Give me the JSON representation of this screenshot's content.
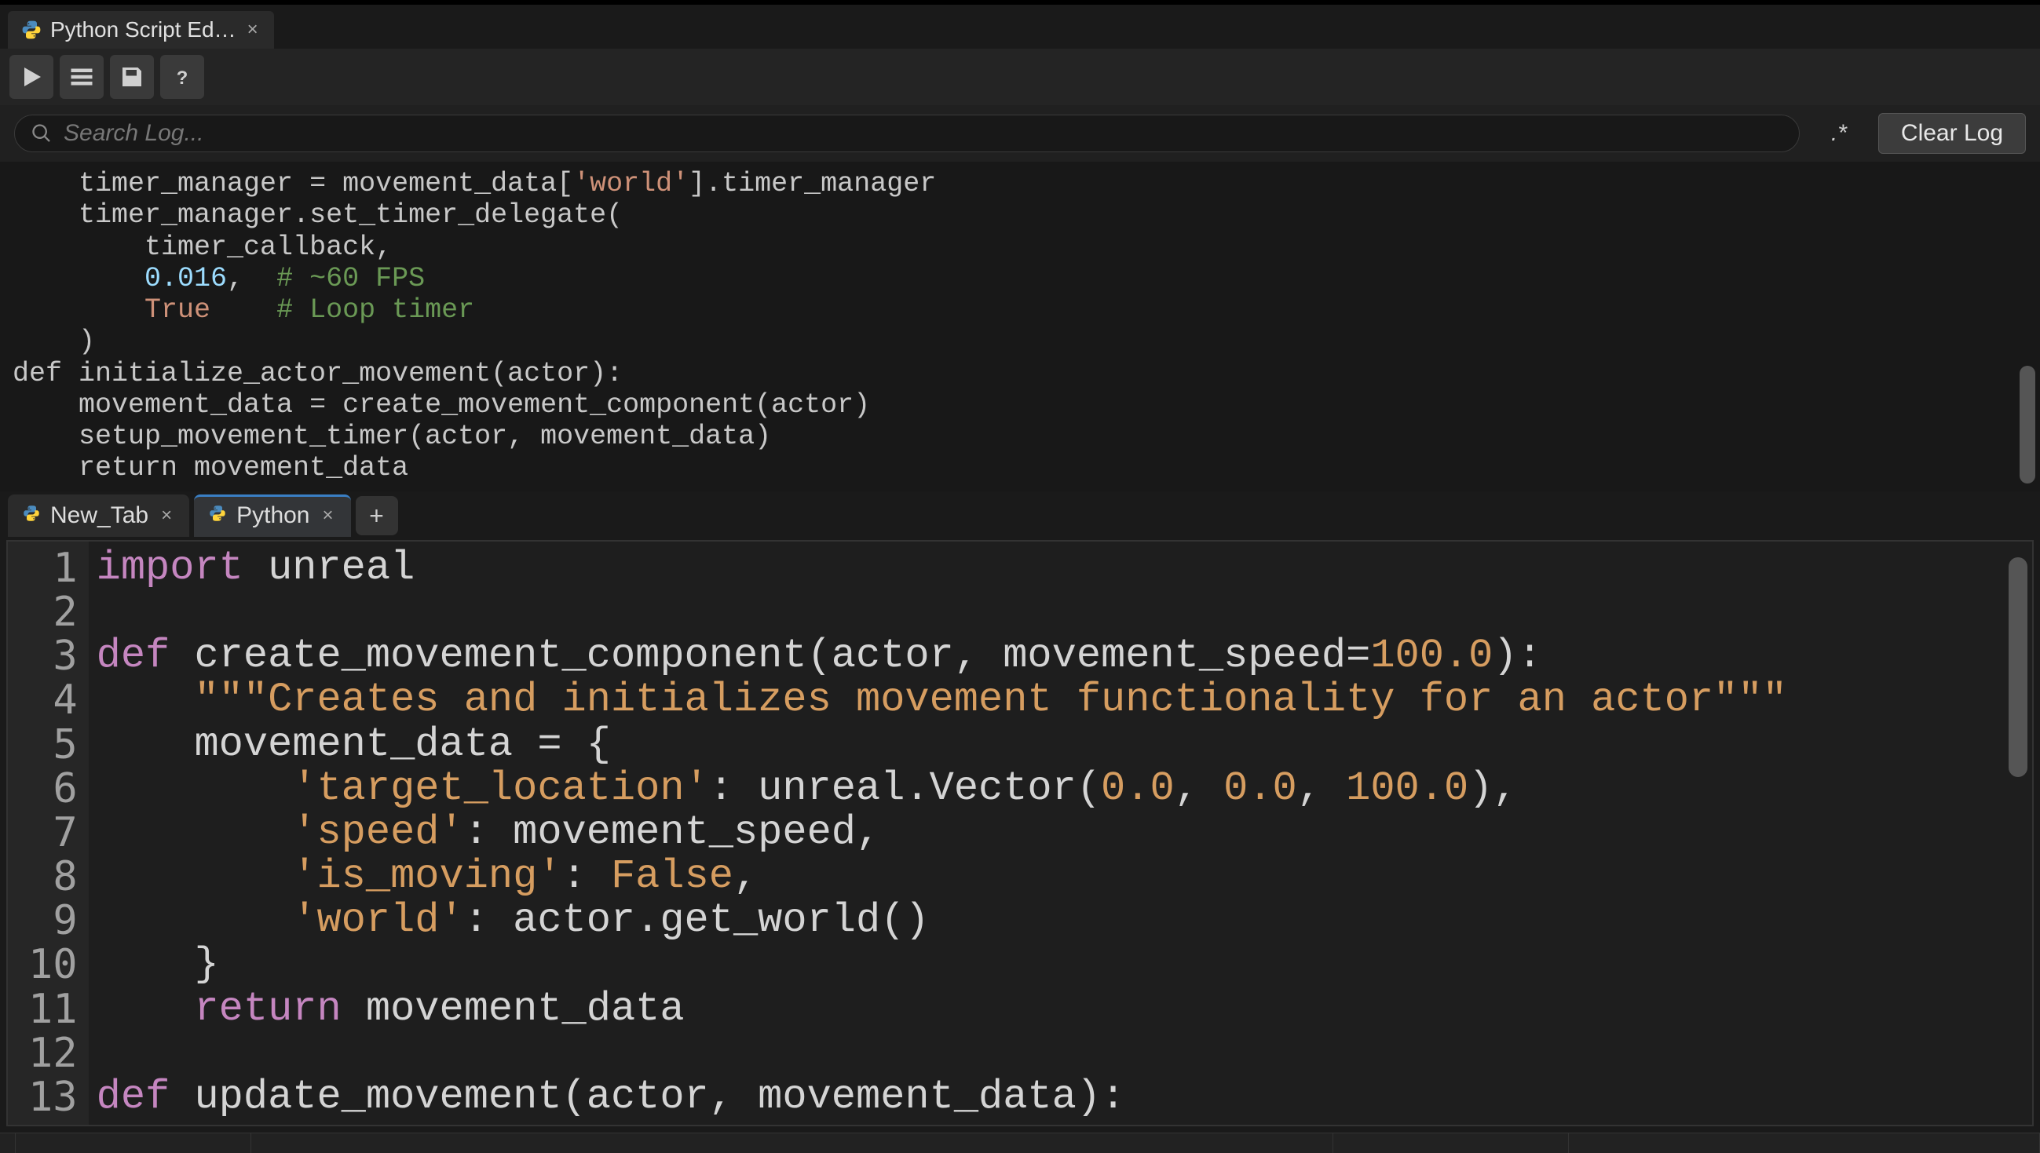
{
  "title_tab": {
    "label": "Python Script Ed…",
    "icon": "python-icon"
  },
  "toolbar": {
    "run": "run-icon",
    "list": "list-icon",
    "save": "save-icon",
    "help": "help-icon"
  },
  "search": {
    "placeholder": "Search Log...",
    "regex_label": ".*",
    "clear_label": "Clear Log"
  },
  "log_lines": [
    {
      "indent": 4,
      "segments": [
        {
          "t": "timer_manager = movement_data["
        },
        {
          "t": "'world'",
          "c": "log-str"
        },
        {
          "t": "].timer_manager"
        }
      ]
    },
    {
      "indent": 4,
      "segments": [
        {
          "t": "timer_manager.set_timer_delegate("
        }
      ]
    },
    {
      "indent": 8,
      "segments": [
        {
          "t": "timer_callback,"
        }
      ]
    },
    {
      "indent": 8,
      "segments": [
        {
          "t": "0.016",
          "c": "log-num"
        },
        {
          "t": ",  "
        },
        {
          "t": "# ~60 FPS",
          "c": "log-comment"
        }
      ]
    },
    {
      "indent": 8,
      "segments": [
        {
          "t": "True",
          "c": "log-bool"
        },
        {
          "t": "    "
        },
        {
          "t": "# Loop timer",
          "c": "log-comment"
        }
      ]
    },
    {
      "indent": 4,
      "segments": [
        {
          "t": ")"
        }
      ]
    },
    {
      "indent": 0,
      "segments": [
        {
          "t": ""
        }
      ]
    },
    {
      "indent": 0,
      "segments": [
        {
          "t": "def initialize_actor_movement(actor):"
        }
      ]
    },
    {
      "indent": 4,
      "segments": [
        {
          "t": "movement_data = create_movement_component(actor)"
        }
      ]
    },
    {
      "indent": 4,
      "segments": [
        {
          "t": "setup_movement_timer(actor, movement_data)"
        }
      ]
    },
    {
      "indent": 4,
      "segments": [
        {
          "t": "return movement_data"
        }
      ]
    }
  ],
  "editor_tabs": [
    {
      "label": "New_Tab",
      "active": false
    },
    {
      "label": "Python",
      "active": true
    }
  ],
  "add_tab_label": "+",
  "code_lines": [
    {
      "n": 1,
      "segments": [
        {
          "t": "import",
          "c": "tok-import"
        },
        {
          "t": " unreal"
        }
      ]
    },
    {
      "n": 2,
      "segments": [
        {
          "t": ""
        }
      ]
    },
    {
      "n": 3,
      "segments": [
        {
          "t": "def",
          "c": "tok-def"
        },
        {
          "t": " create_movement_component(actor, movement_speed="
        },
        {
          "t": "100.0",
          "c": "tok-num"
        },
        {
          "t": "):"
        }
      ]
    },
    {
      "n": 4,
      "segments": [
        {
          "t": "    "
        },
        {
          "t": "\"\"\"Creates and initializes movement functionality for an actor\"\"\"",
          "c": "tok-doc"
        }
      ]
    },
    {
      "n": 5,
      "segments": [
        {
          "t": "    movement_data = {"
        }
      ]
    },
    {
      "n": 6,
      "segments": [
        {
          "t": "        "
        },
        {
          "t": "'target_location'",
          "c": "tok-str"
        },
        {
          "t": ": unreal.Vector("
        },
        {
          "t": "0.0",
          "c": "tok-num"
        },
        {
          "t": ", "
        },
        {
          "t": "0.0",
          "c": "tok-num"
        },
        {
          "t": ", "
        },
        {
          "t": "100.0",
          "c": "tok-num"
        },
        {
          "t": "),"
        }
      ]
    },
    {
      "n": 7,
      "segments": [
        {
          "t": "        "
        },
        {
          "t": "'speed'",
          "c": "tok-str"
        },
        {
          "t": ": movement_speed,"
        }
      ]
    },
    {
      "n": 8,
      "segments": [
        {
          "t": "        "
        },
        {
          "t": "'is_moving'",
          "c": "tok-str"
        },
        {
          "t": ": "
        },
        {
          "t": "False",
          "c": "tok-bool"
        },
        {
          "t": ","
        }
      ]
    },
    {
      "n": 9,
      "segments": [
        {
          "t": "        "
        },
        {
          "t": "'world'",
          "c": "tok-str"
        },
        {
          "t": ": actor.get_world()"
        }
      ]
    },
    {
      "n": 10,
      "segments": [
        {
          "t": "    }"
        }
      ]
    },
    {
      "n": 11,
      "segments": [
        {
          "t": "    "
        },
        {
          "t": "return",
          "c": "tok-ret"
        },
        {
          "t": " movement_data"
        }
      ]
    },
    {
      "n": 12,
      "segments": [
        {
          "t": ""
        }
      ]
    },
    {
      "n": 13,
      "segments": [
        {
          "t": "def",
          "c": "tok-def"
        },
        {
          "t": " update_movement(actor, movement_data):"
        }
      ]
    }
  ]
}
